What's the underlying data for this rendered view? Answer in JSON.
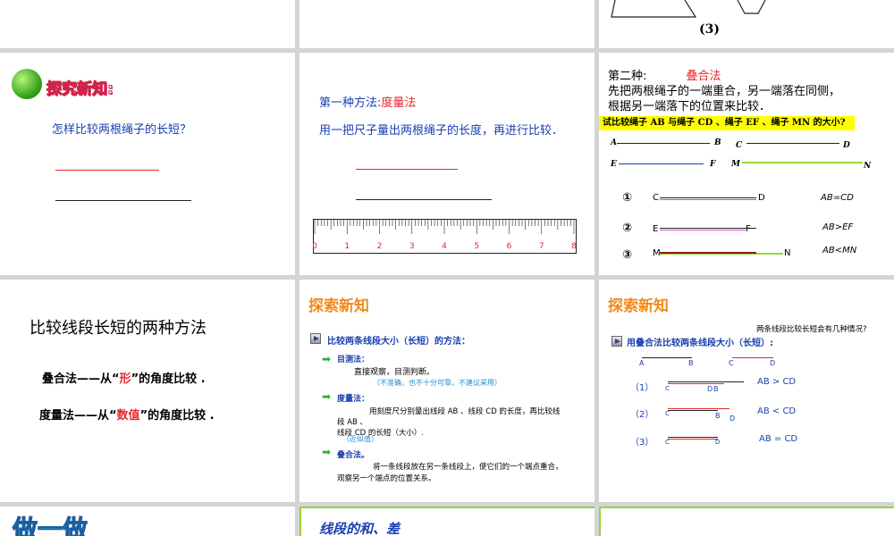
{
  "slides": {
    "s3": {
      "figure_label": "(3)"
    },
    "s4": {
      "heading": "探究新知:",
      "question": "怎样比较两根绳子的长短？"
    },
    "s5": {
      "method_prefix": "第一种方法:",
      "method_name": "度量法",
      "body": "用一把尺子量出两根绳子的长度，再进行比较．",
      "ruler_numbers": [
        "0",
        "1",
        "2",
        "3",
        "4",
        "5",
        "6",
        "7",
        "8"
      ]
    },
    "s6": {
      "prefix": "第二种:",
      "method_name": "叠合法",
      "line1": "先把两根绳子的一端重合，另一端落在同侧，",
      "line2": "根据另一端落下的位置来比较．",
      "question": "试比较绳子 AB 与绳子 CD 、绳子 EF 、绳子 MN 的大小?",
      "labels": {
        "A": "A",
        "B": "B",
        "C": "C",
        "D": "D",
        "E": "E",
        "F": "F",
        "M": "M",
        "N": "N"
      },
      "cases": [
        {
          "num": "①",
          "left": "C",
          "right": "D",
          "result": "AB=CD"
        },
        {
          "num": "②",
          "left": "E",
          "right": "F",
          "result": "AB>EF"
        },
        {
          "num": "③",
          "left": "M",
          "right": "N",
          "result": "AB<MN"
        }
      ]
    },
    "s7": {
      "title": "比较线段长短的两种方法",
      "row1_prefix": "叠合法——从“",
      "row1_key": "形",
      "row1_suffix": "”的角度比较 .",
      "row2_prefix": "度量法——从“",
      "row2_key": "数值",
      "row2_suffix": "”的角度比较 ."
    },
    "s8": {
      "heading": "探索新知",
      "sub": "比较两条线段大小（长短）的方法：",
      "m1": "目测法：",
      "m1_text": "直接观察，目测判断。",
      "m1_note": "（不准确，也不十分可靠，不建议采用）",
      "m2": "度量法：",
      "m2_text1": "用刻度尺分别量出线段 AB 、线段 CD 的长度，再比较线",
      "m2_text2": "段 AB 、",
      "m2_text3": "线段 CD 的长短（大小）.",
      "m2_note": "（近似值）",
      "m3": "叠合法。",
      "m3_text1": "将一条线段放在另一条线段上，使它们的一个端点重合，",
      "m3_text2": "观察另一个端点的位置关系。"
    },
    "s9": {
      "heading": "探索新知",
      "question": "两条线段比较长短会有几种情况?",
      "sub": "用叠合法比较两条线段大小（长短）:",
      "labels": {
        "A": "A",
        "B": "B",
        "C": "C",
        "D": "D",
        "CA": "C\nA"
      },
      "cases": [
        {
          "num": "（1）",
          "result": "AB > CD",
          "left": "C\nA",
          "mid": "D",
          "right": "B"
        },
        {
          "num": "（2）",
          "result": "AB < CD",
          "left": "C\nA",
          "mid": "B",
          "right": "D"
        },
        {
          "num": "（3）",
          "result": "AB = CD",
          "left": "C\nA",
          "right": "D\nB"
        }
      ]
    },
    "s10": {
      "heading": "做一做"
    },
    "s11": {
      "heading": "线段的和、差"
    }
  },
  "colors": {
    "red": "#e8262a",
    "blue": "#1a3fb0",
    "pink": "#e040e0",
    "green": "#9ad43a",
    "gray": "#d4d4d4"
  }
}
